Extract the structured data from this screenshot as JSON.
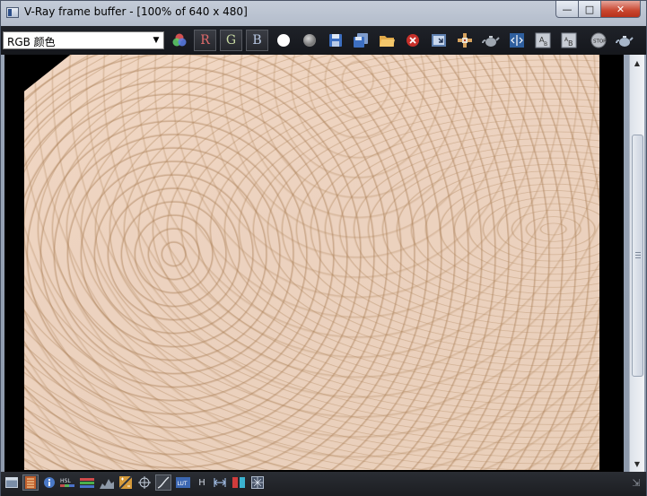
{
  "window": {
    "title": "V-Ray frame buffer - [100% of 640 x 480]",
    "controls": {
      "minimize": "—",
      "maximize": "□",
      "close": "✕"
    }
  },
  "toolbar": {
    "channel_select": {
      "value": "RGB 颜色",
      "arrow": "▼"
    },
    "channels": {
      "red": "R",
      "green": "G",
      "blue": "B"
    }
  },
  "bottombar": {
    "hsv_label": "H",
    "resize_glyph": "⇲"
  },
  "icons": [
    "color-picker-icon",
    "white-circle-icon",
    "gray-circle-icon",
    "save-icon",
    "save-all-icon",
    "open-icon",
    "clear-icon",
    "region-icon",
    "link-icon",
    "teapot-icon",
    "compare-icon",
    "history-a-icon",
    "history-b-icon",
    "stop-icon",
    "render-teapot-icon"
  ],
  "colors": {
    "toolbar_bg": "#1a1c21",
    "render_base": "#ecd2bf",
    "accent_red": "#c7302a"
  }
}
